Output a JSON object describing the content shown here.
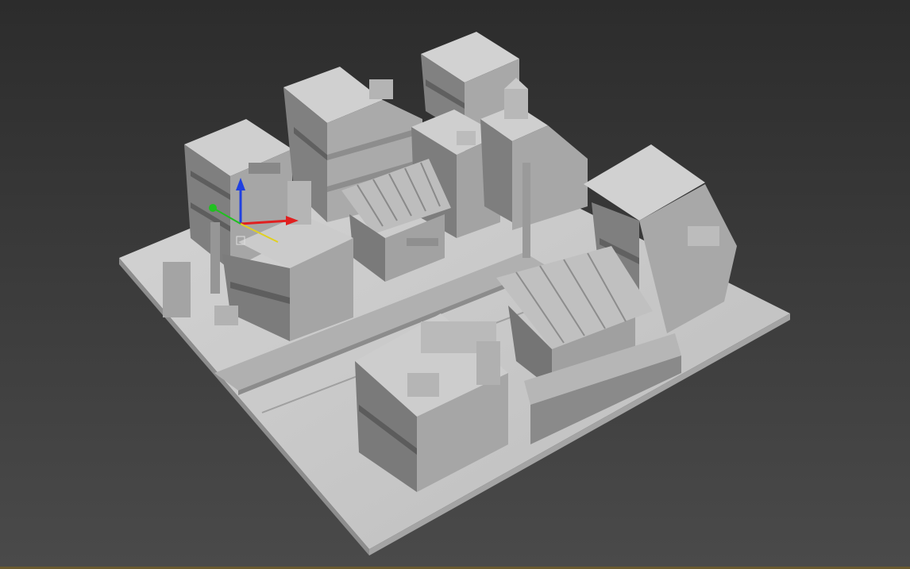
{
  "viewport": {
    "kind": "3d-perspective-viewport",
    "shading": "default-gray",
    "background_top": "#2c2c2c",
    "background_bottom": "#4a4a4a"
  },
  "scene": {
    "description_icons": [
      "city-block-model"
    ],
    "colors": {
      "top": "#c9c9c9",
      "left": "#8a8a8a",
      "right": "#a9a9a9",
      "roof_tile": "#b9b9b9",
      "shadow": "#4a4a4a"
    }
  },
  "gizmo": {
    "x_axis_color": "#e02020",
    "y_axis_color": "#e0d020",
    "z_axis_color": "#2040e0",
    "pivot_color": "#20c020"
  }
}
